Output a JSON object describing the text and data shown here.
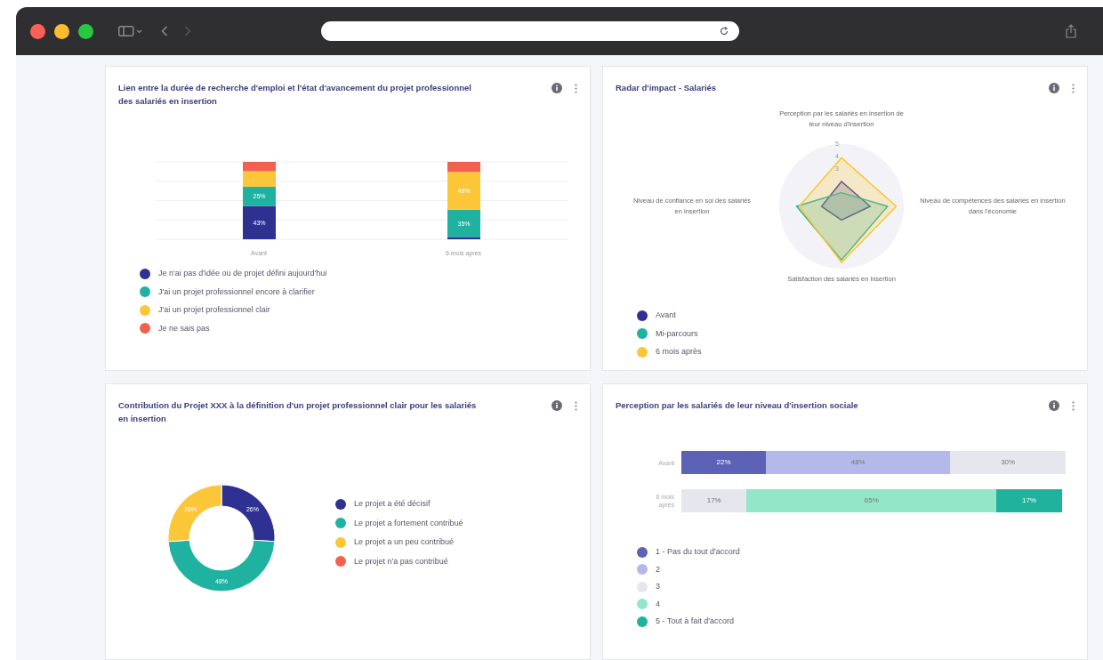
{
  "cards": [
    {
      "title": "Lien entre la durée de recherche d'emploi et l'état d'avancement du projet professionnel des salariés en insertion",
      "chart_data": {
        "type": "bar",
        "orientation": "vertical",
        "stacked": true,
        "categories": [
          "Avant",
          "6 mois après"
        ],
        "series": [
          {
            "name": "Je n'ai pas d'idée ou de projet défini aujourd'hui",
            "color": "#2e3192",
            "values": [
              43,
              3
            ],
            "value_labels": [
              "43%",
              null
            ]
          },
          {
            "name": "J'ai un projet professionnel encore à clarifier",
            "color": "#20b2a0",
            "values": [
              25,
              35
            ],
            "value_labels": [
              "25%",
              "35%"
            ]
          },
          {
            "name": "J'ai un projet professionnel clair",
            "color": "#fbc638",
            "values": [
              20,
              49
            ],
            "value_labels": [
              null,
              "49%"
            ]
          },
          {
            "name": "Je ne sais pas",
            "color": "#f4604f",
            "values": [
              12,
              13
            ],
            "value_labels": [
              null,
              null
            ]
          }
        ]
      }
    },
    {
      "title": "Radar d'impact - Salariés",
      "chart_data": {
        "type": "radar",
        "ylim": [
          0,
          5
        ],
        "yticks": [
          3,
          4,
          5
        ],
        "categories": [
          "Perception par les salariés en insertion de leur niveau d'insertion",
          "Niveau de compétences des salariés en insertion dans l'économie",
          "Satisfaction des salariés en insertion",
          "Niveau de confiance en soi des salariés en insertion"
        ],
        "series": [
          {
            "name": "Avant",
            "color": "#2e3192",
            "values": [
              2,
              2.3,
              1.1,
              1.6
            ]
          },
          {
            "name": "Mi-parcours",
            "color": "#20b2a0",
            "values": [
              1.1,
              3.7,
              4.3,
              3.6
            ]
          },
          {
            "name": "6 mois après",
            "color": "#fbc638",
            "values": [
              3.9,
              4.4,
              4.5,
              3.4
            ]
          }
        ]
      }
    },
    {
      "title": "Contribution du Projet XXX à la définition d'un projet professionnel clair pour les salariés en insertion",
      "chart_data": {
        "type": "donut",
        "categories": [
          "Le projet a été décisif",
          "Le projet a fortement contribué",
          "Le projet a un peu contribué",
          "Le projet n'a pas contribué"
        ],
        "values": [
          26,
          48,
          26,
          0
        ],
        "colors": [
          "#2e3192",
          "#20b2a0",
          "#fbc638",
          "#f4604f"
        ],
        "value_labels": [
          "26%",
          "48%",
          "26%",
          null
        ]
      }
    },
    {
      "title": "Perception par les salariés de leur niveau d'insertion sociale",
      "chart_data": {
        "type": "bar",
        "orientation": "horizontal",
        "stacked": true,
        "categories": [
          "Avant",
          "6 mois après"
        ],
        "series": [
          {
            "name": "1 - Pas du tout d'accord",
            "color": "#5c62b5",
            "values": [
              22,
              null
            ],
            "value_labels": [
              "22%",
              null
            ]
          },
          {
            "name": "2",
            "color": "#b4b9ea",
            "values": [
              48,
              null
            ],
            "value_labels": [
              "48%",
              null
            ]
          },
          {
            "name": "3",
            "color": "#e5e6ee",
            "values": [
              30,
              17
            ],
            "value_labels": [
              "30%",
              "17%"
            ]
          },
          {
            "name": "4",
            "color": "#94e6c8",
            "values": [
              null,
              65
            ],
            "value_labels": [
              null,
              "65%"
            ]
          },
          {
            "name": "5 - Tout à fait d'accord",
            "color": "#1fb39e",
            "values": [
              null,
              17
            ],
            "value_labels": [
              null,
              "17%"
            ]
          }
        ]
      }
    }
  ]
}
